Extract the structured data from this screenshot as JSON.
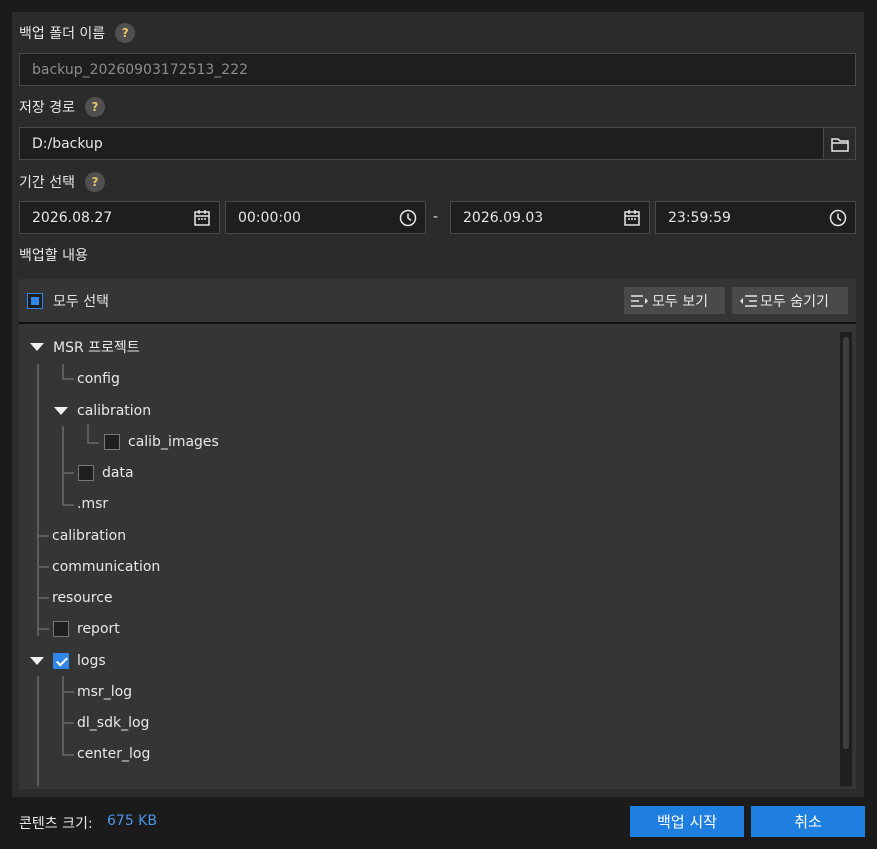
{
  "form": {
    "folder_name_label": "백업 폴더 이름",
    "folder_name_value": "backup_20260903172513_222",
    "save_path_label": "저장 경로",
    "save_path_value": "D:/backup",
    "period_label": "기간 선택",
    "start_date": "2026.08.27",
    "start_time": "00:00:00",
    "range_separator": "-",
    "end_date": "2026.09.03",
    "end_time": "23:59:59",
    "content_label": "백업할 내용",
    "help_glyph": "?"
  },
  "tree": {
    "select_all_label": "모두 선택",
    "select_all_state": "partial",
    "expand_all_label": "모두 보기",
    "collapse_all_label": "모두 숨기기",
    "items": [
      {
        "label": "MSR 프로젝트",
        "expanded": true
      },
      {
        "label": "config"
      },
      {
        "label": "calibration",
        "expanded": true
      },
      {
        "label": "calib_images",
        "checked": false
      },
      {
        "label": "data",
        "checked": false
      },
      {
        "label": ".msr"
      },
      {
        "label": "calibration"
      },
      {
        "label": "communication"
      },
      {
        "label": "resource"
      },
      {
        "label": "report",
        "checked": false
      },
      {
        "label": "logs",
        "expanded": true,
        "checked": true
      },
      {
        "label": "msr_log"
      },
      {
        "label": "dl_sdk_log"
      },
      {
        "label": "center_log"
      }
    ]
  },
  "footer": {
    "content_size_label": "콘텐츠 크기:",
    "content_size_value": "675 KB",
    "start_backup_label": "백업 시작",
    "cancel_label": "취소"
  },
  "colors": {
    "accent": "#1f7fe0",
    "size_text": "#4a94ea",
    "help_icon": "#e3c46a"
  },
  "icons": {
    "help": "question-icon",
    "folder": "folder-icon",
    "calendar": "calendar-icon",
    "clock": "clock-icon",
    "expand": "expand-all-icon",
    "collapse": "collapse-all-icon",
    "caret": "caret-down-icon"
  }
}
